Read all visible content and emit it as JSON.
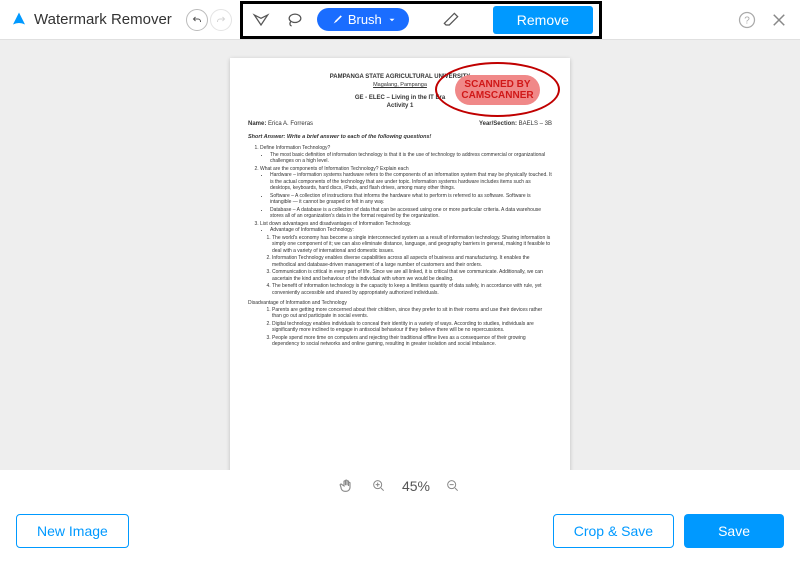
{
  "header": {
    "app_title": "Watermark Remover",
    "brush_label": "Brush",
    "remove_label": "Remove"
  },
  "watermark": {
    "line1": "SCANNED BY",
    "line2": "CAMSCANNER"
  },
  "document": {
    "university": "PAMPANGA STATE AGRICULTURAL UNIVERSITY",
    "location": "Magalang, Pampanga",
    "course": "GE - ELEC – Living in the IT Era",
    "activity": "Activity 1",
    "name_label": "Name:",
    "name_value": "Erica A. Forreras",
    "section_label": "Year/Section:",
    "section_value": "BAELS – 3B",
    "short_answer_label": "Short Answer:",
    "short_answer_instr": "Write a brief answer to each of the following questions!",
    "q1": "Define Information Technology?",
    "q1_a": "The most basic definition of information technology is that it is the use of technology to address commercial or organizational challenges on a high level.",
    "q2": "What are the components of Information Technology? Explain each",
    "q2_a": "Hardware – information systems hardware refers to the components of an information system that may be physically touched. It is the actual components of the technology that are under topic. Information systems hardware includes items such as desktops, keyboards, hard discs, iPads, and flash drives, among many other things.",
    "q2_b": "Software – A collection of instructions that informs the hardware what to perform is referred to as software. Software is intangible — it cannot be grasped or felt in any way.",
    "q2_c": "Database – A database is a collection of data that can be accessed using one or more particular criteria. A data warehouse stores all of an organization's data in the format required by the organization.",
    "q3": "List down advantages and disadvantages of Information Technology.",
    "q3_adv_title": "Advantage of Information Technology:",
    "q3_adv_1": "The world's economy has become a single interconnected system as a result of information technology. Sharing information is simply one component of it; we can also eliminate distance, language, and geography barriers in general, making it feasible to deal with a variety of international and domestic issues.",
    "q3_adv_2": "Information Technology enables diverse capabilities across all aspects of business and manufacturing. It enables the methodical and database-driven management of a large number of customers and their orders.",
    "q3_adv_3": "Communication is critical in every part of life. Since we are all linked, it is critical that we communicate. Additionally, we can ascertain the kind and behaviour of the individual with whom we would be dealing.",
    "q3_adv_4": "The benefit of information technology is the capacity to keep a limitless quantity of data safely, in accordance with rule, yet conveniently accessible and shared by appropriately authorized individuals.",
    "q3_dis_title": "Disadvantage of Information and Technology",
    "q3_dis_1": "Parents are getting more concerned about their children, since they prefer to sit in their rooms and use their devices rather than go out and participate in social events.",
    "q3_dis_2": "Digital technology enables individuals to conceal their identity in a variety of ways. According to studies, individuals are significantly more inclined to engage in antisocial behaviour if they believe there will be no repercussions.",
    "q3_dis_3": "People spend more time on computers and rejecting their traditional offline lives as a consequence of their growing dependency to social networks and online gaming, resulting in greater isolation and social imbalance."
  },
  "zoom": {
    "level": "45%"
  },
  "footer": {
    "new_image": "New Image",
    "crop_save": "Crop & Save",
    "save": "Save"
  },
  "colors": {
    "primary": "#0099ff",
    "brush": "#1a6dff",
    "watermark_ring": "#c00000"
  }
}
